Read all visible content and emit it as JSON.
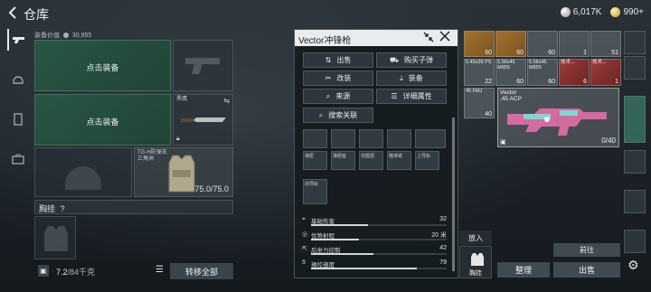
{
  "header": {
    "back_icon": "back-arrow-icon",
    "title": "仓库",
    "currency": {
      "silver": "6,017K",
      "gold": "990+"
    }
  },
  "equipment": {
    "value_label": "装备价值",
    "value": "30,955",
    "equip_slot_1": "点击装备",
    "equip_slot_2": "点击装备",
    "knife_caption": "黑鹰",
    "armor_caption_line1": "TG-H防弹衣",
    "armor_caption_line2": "三角洲",
    "armor_durability": "75.0/75.0",
    "chest_label": "胸挂",
    "chest_help": "?",
    "weight": "7.2",
    "weight_capacity": "/84千克",
    "transfer_all": "转移全部"
  },
  "modal": {
    "title": "Vector冲锋枪",
    "buttons": [
      {
        "label": "出售",
        "icon": "sell-icon"
      },
      {
        "label": "购买子弹",
        "icon": "buy-ammo-icon"
      },
      {
        "label": "改装",
        "icon": "modify-icon"
      },
      {
        "label": "装备",
        "icon": "equip-icon"
      },
      {
        "label": "来源",
        "icon": "source-icon"
      },
      {
        "label": "详细属性",
        "icon": "details-icon"
      }
    ],
    "search_mods": "搜索关联",
    "attachment_labels": [
      "弹匣",
      "弹匣座",
      "前握把",
      "瞄准镜",
      "上导轨",
      "前导轨"
    ],
    "stats": [
      {
        "name": "基础伤害",
        "value": "32",
        "fill": 0.42
      },
      {
        "name": "优势射程",
        "value": "20 米",
        "fill": 0.35
      },
      {
        "name": "后坐力控制",
        "value": "42",
        "fill": 0.46
      },
      {
        "name": "操控速度",
        "value": "79",
        "fill": 0.78
      }
    ]
  },
  "inventory": {
    "row1": [
      {
        "cap": "",
        "num": "60",
        "color": "orange"
      },
      {
        "cap": "",
        "num": "60",
        "color": "orange"
      },
      {
        "cap": "",
        "num": "60",
        "color": "grey"
      },
      {
        "cap": "",
        "num": "1",
        "color": "grey"
      },
      {
        "cap": "",
        "num": "51",
        "color": "grey"
      }
    ],
    "row2": [
      {
        "cap": "5.45x39 PS",
        "num": "22",
        "color": "grey"
      },
      {
        "cap": "5.56x45 M855",
        "num": "60",
        "color": "grey"
      },
      {
        "cap": "5.56x45 M855",
        "num": "60",
        "color": "grey"
      },
      {
        "cap": "技术...",
        "num": "6",
        "color": "red"
      },
      {
        "cap": "技术...",
        "num": "1",
        "color": "red"
      }
    ],
    "row3_left": {
      "cap": "45 FMJ",
      "num": "40"
    },
    "vector": {
      "name": "Vector",
      "sub": ".45 ACP",
      "ammo": "0/40"
    }
  },
  "bottom_right": {
    "drop": "放入",
    "hang": "胸挂",
    "go": "前往",
    "sort": "整理",
    "sell": "出售"
  }
}
